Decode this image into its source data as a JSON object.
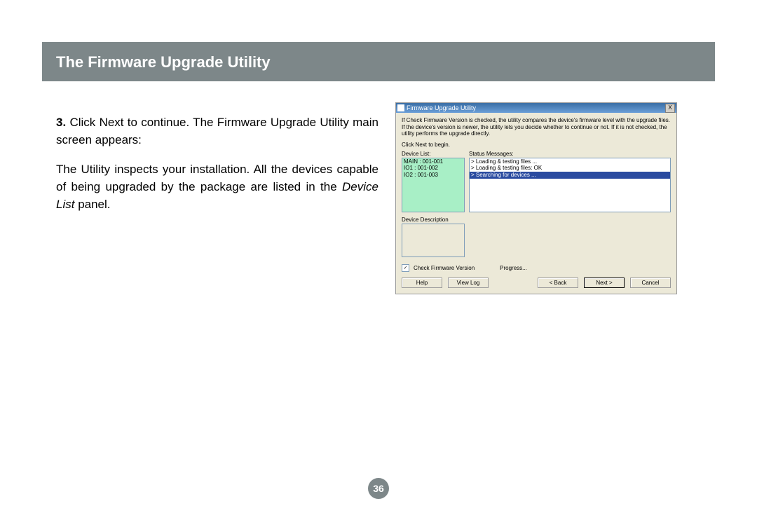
{
  "header": {
    "title": "The Firmware Upgrade Utility"
  },
  "text": {
    "step_num": "3.",
    "step_text": "Click Next to continue. The Firmware Upgrade Utility main screen appears:",
    "desc_pre": "The Utility inspects your installation. All the devices capable of being upgraded by the package are listed in the ",
    "desc_italic": "Device List",
    "desc_post": " panel."
  },
  "dialog": {
    "title": "Firmware Upgrade Utility",
    "close": "X",
    "intro": "If Check Firmware Version is checked, the utility compares the device's firmware level with the upgrade files. If the device's version is newer, the utility lets you decide whether to continue or not. If it is not checked, the utility performs the upgrade directly.",
    "click_next": "Click Next to begin.",
    "device_list_label": "Device List:",
    "status_label": "Status Messages:",
    "devices": [
      "MAIN : 001-001",
      "IO1 : 001-002",
      "IO2 : 001-003"
    ],
    "status": [
      {
        "t": "> Loading & testing files ...",
        "hl": false
      },
      {
        "t": "> Loading & testing files: OK",
        "hl": false
      },
      {
        "t": "> Searching for devices ...",
        "hl": true
      }
    ],
    "desc_label": "Device Description",
    "check_label": "Check Firmware Version",
    "progress_label": "Progress...",
    "buttons": {
      "help": "Help",
      "viewlog": "View Log",
      "back": "< Back",
      "next": "Next >",
      "cancel": "Cancel"
    }
  },
  "page_number": "36"
}
